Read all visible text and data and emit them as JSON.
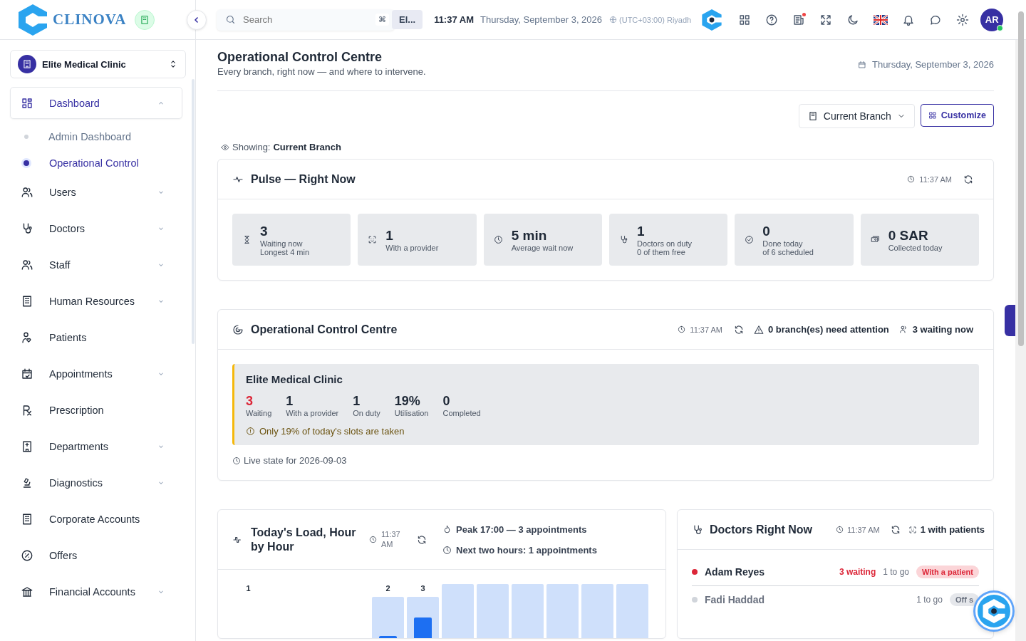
{
  "header": {
    "logo_text": "CLINOVA",
    "search_placeholder": "Search",
    "shortcut": "⌘",
    "branch_chip": "El...",
    "time": "11:37 AM",
    "date": "Thursday, September 3, 2026",
    "timezone": "(UTC+03:00) Riyadh",
    "avatar": "AR",
    "news_unread": true,
    "online": true
  },
  "sidebar": {
    "clinic": "Elite Medical Clinic",
    "items": [
      {
        "label": "Dashboard",
        "selected": true,
        "expandable": true,
        "expanded": true,
        "children": [
          {
            "label": "Admin Dashboard",
            "selected": false
          },
          {
            "label": "Operational Control",
            "selected": true
          }
        ]
      },
      {
        "label": "Users",
        "selected": false,
        "expandable": true,
        "expanded": false
      },
      {
        "label": "Doctors",
        "selected": false,
        "expandable": true,
        "expanded": false
      },
      {
        "label": "Staff",
        "selected": false,
        "expandable": true,
        "expanded": false
      },
      {
        "label": "Human Resources",
        "selected": false,
        "expandable": true,
        "expanded": false
      },
      {
        "label": "Patients",
        "selected": false,
        "expandable": false
      },
      {
        "label": "Appointments",
        "selected": false,
        "expandable": true,
        "expanded": false
      },
      {
        "label": "Prescription",
        "selected": false,
        "expandable": false
      },
      {
        "label": "Departments",
        "selected": false,
        "expandable": true,
        "expanded": false
      },
      {
        "label": "Diagnostics",
        "selected": false,
        "expandable": true,
        "expanded": false
      },
      {
        "label": "Corporate Accounts",
        "selected": false,
        "expandable": false
      },
      {
        "label": "Offers",
        "selected": false,
        "expandable": false
      },
      {
        "label": "Financial Accounts",
        "selected": false,
        "expandable": true,
        "expanded": false
      }
    ]
  },
  "page": {
    "title": "Operational Control Centre",
    "subtitle": "Every branch, right now — and where to intervene.",
    "date": "Thursday, September 3, 2026",
    "branch_select": "Current Branch",
    "customize": "Customize",
    "showing_label": "Showing:",
    "showing_value": "Current Branch"
  },
  "pulse": {
    "title": "Pulse — Right Now",
    "time": "11:37 AM",
    "stats": [
      {
        "value": "3",
        "lines": [
          "Waiting now",
          "Longest 4 min"
        ]
      },
      {
        "value": "1",
        "lines": [
          "With a provider"
        ]
      },
      {
        "value": "5 min",
        "lines": [
          "Average wait now"
        ]
      },
      {
        "value": "1",
        "lines": [
          "Doctors on duty",
          "0 of them free"
        ]
      },
      {
        "value": "0",
        "lines": [
          "Done today",
          "of 6 scheduled"
        ]
      },
      {
        "value": "0 SAR",
        "lines": [
          "Collected today"
        ]
      }
    ]
  },
  "control": {
    "title": "Operational Control Centre",
    "time": "11:37 AM",
    "attention": "0 branch(es) need attention",
    "waiting": "3 waiting now",
    "branch": {
      "name": "Elite Medical Clinic",
      "metrics": [
        {
          "value": "3",
          "label": "Waiting",
          "alert": true
        },
        {
          "value": "1",
          "label": "With a provider",
          "alert": false
        },
        {
          "value": "1",
          "label": "On duty",
          "alert": false
        },
        {
          "value": "19%",
          "label": "Utilisation",
          "alert": false
        },
        {
          "value": "0",
          "label": "Completed",
          "alert": false
        }
      ],
      "warning": "Only 19% of today's slots are taken"
    },
    "footer": "Live state for 2026-09-03"
  },
  "load": {
    "title": "Today's Load, Hour by Hour",
    "time": "11:37 AM",
    "peak": "Peak 17:00 — 3 appointments",
    "next": "Next two hours: 1 appointments",
    "bars": [
      {
        "kind": "empty",
        "label": "1"
      },
      {
        "kind": "empty"
      },
      {
        "kind": "empty"
      },
      {
        "kind": "empty"
      },
      {
        "kind": "bar",
        "label": "2",
        "level": 0.05
      },
      {
        "kind": "bar",
        "label": "3",
        "level": 0.5
      },
      {
        "kind": "bar"
      },
      {
        "kind": "bar"
      },
      {
        "kind": "bar"
      },
      {
        "kind": "bar"
      },
      {
        "kind": "bar"
      },
      {
        "kind": "bar"
      }
    ]
  },
  "doctors": {
    "title": "Doctors Right Now",
    "time": "11:37 AM",
    "with_patients": "1 with patients",
    "rows": [
      {
        "name": "Adam Reyes",
        "active": true,
        "color": "#dc2638",
        "waiting": "3 waiting",
        "to_go": "1 to go",
        "status": "With a patient",
        "kind": "busy"
      },
      {
        "name": "Fadi Haddad",
        "active": false,
        "color": "#d1d5db",
        "to_go": "1 to go",
        "status": "Off s",
        "kind": "off"
      }
    ]
  }
}
